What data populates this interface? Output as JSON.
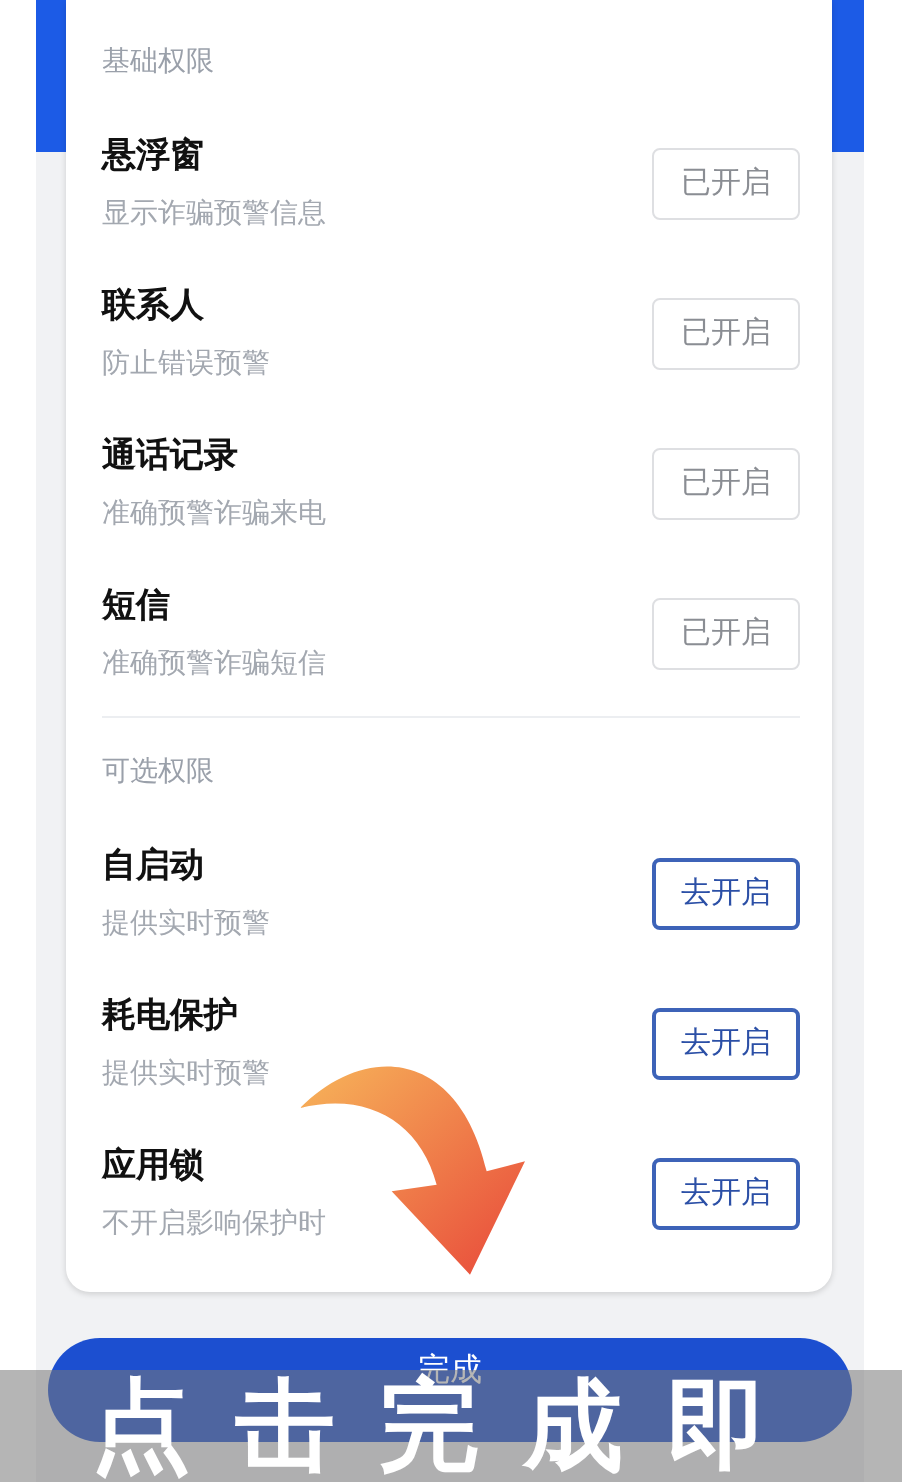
{
  "sections": [
    {
      "title": "基础权限",
      "items": [
        {
          "name": "悬浮窗",
          "desc": "显示诈骗预警信息",
          "button": "已开启",
          "enabled": true
        },
        {
          "name": "联系人",
          "desc": "防止错误预警",
          "button": "已开启",
          "enabled": true
        },
        {
          "name": "通话记录",
          "desc": "准确预警诈骗来电",
          "button": "已开启",
          "enabled": true
        },
        {
          "name": "短信",
          "desc": "准确预警诈骗短信",
          "button": "已开启",
          "enabled": true
        }
      ]
    },
    {
      "title": "可选权限",
      "items": [
        {
          "name": "自启动",
          "desc": "提供实时预警",
          "button": "去开启",
          "enabled": false
        },
        {
          "name": "耗电保护",
          "desc": "提供实时预警",
          "button": "去开启",
          "enabled": false
        },
        {
          "name": "应用锁",
          "desc": "不开启影响保护时",
          "button": "去开启",
          "enabled": false
        }
      ]
    }
  ],
  "done_button": "完成",
  "caption": "点击完成即"
}
